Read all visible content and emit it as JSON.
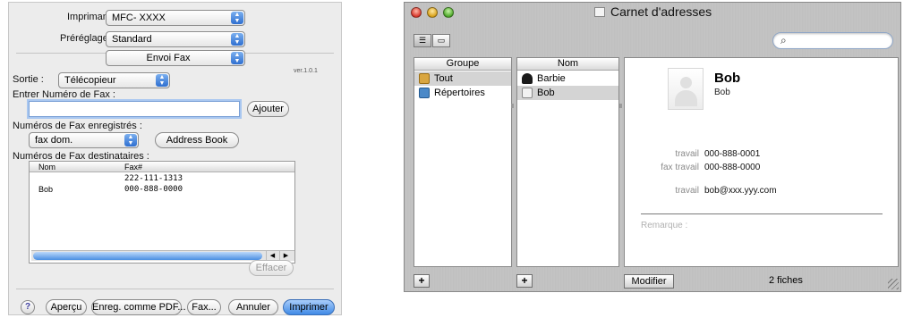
{
  "print_dialog": {
    "printer": {
      "label": "Imprimante :",
      "value": "MFC- XXXX"
    },
    "presets": {
      "label": "Préréglages :",
      "value": "Standard"
    },
    "panel_popup": "Envoi Fax",
    "output": {
      "label": "Sortie :",
      "value": "Télécopieur"
    },
    "version": "ver.1.0.1",
    "fax_entry": {
      "label": "Entrer Numéro de Fax :",
      "value": "",
      "add_button": "Ajouter"
    },
    "saved": {
      "label": "Numéros de Fax enregistrés :",
      "value": "fax dom.",
      "address_book_button": "Address Book"
    },
    "destinations": {
      "label": "Numéros de Fax destinataires :",
      "columns": [
        "Nom",
        "Fax#"
      ],
      "rows": [
        {
          "name": "",
          "fax": "222-111-1313"
        },
        {
          "name": "Bob",
          "fax": "000-888-0000"
        }
      ],
      "delete_button": "Effacer"
    },
    "help": "?",
    "buttons": {
      "preview": "Aperçu",
      "save_pdf": "Enreg. comme PDF...",
      "fax": "Fax...",
      "cancel": "Annuler",
      "print": "Imprimer"
    }
  },
  "address_book": {
    "title": "Carnet d'adresses",
    "search": {
      "value": ""
    },
    "groups": {
      "header": "Groupe",
      "items": [
        "Tout",
        "Répertoires"
      ]
    },
    "names": {
      "header": "Nom",
      "items": [
        "Barbie",
        "Bob"
      ]
    },
    "card": {
      "name": "Bob",
      "subname": "Bob",
      "fields": [
        {
          "label": "travail",
          "value": "000-888-0001"
        },
        {
          "label": "fax travail",
          "value": "000-888-0000"
        },
        {
          "label": "travail",
          "value": "bob@xxx.yyy.com"
        }
      ],
      "note_label": "Remarque :"
    },
    "add_symbol": "+",
    "modify_button": "Modifier",
    "count": "2 fiches"
  },
  "colors": {
    "default_button": "#3f8ae6",
    "selection": "#d4d4d4",
    "field_label": "#8a8a8a"
  }
}
